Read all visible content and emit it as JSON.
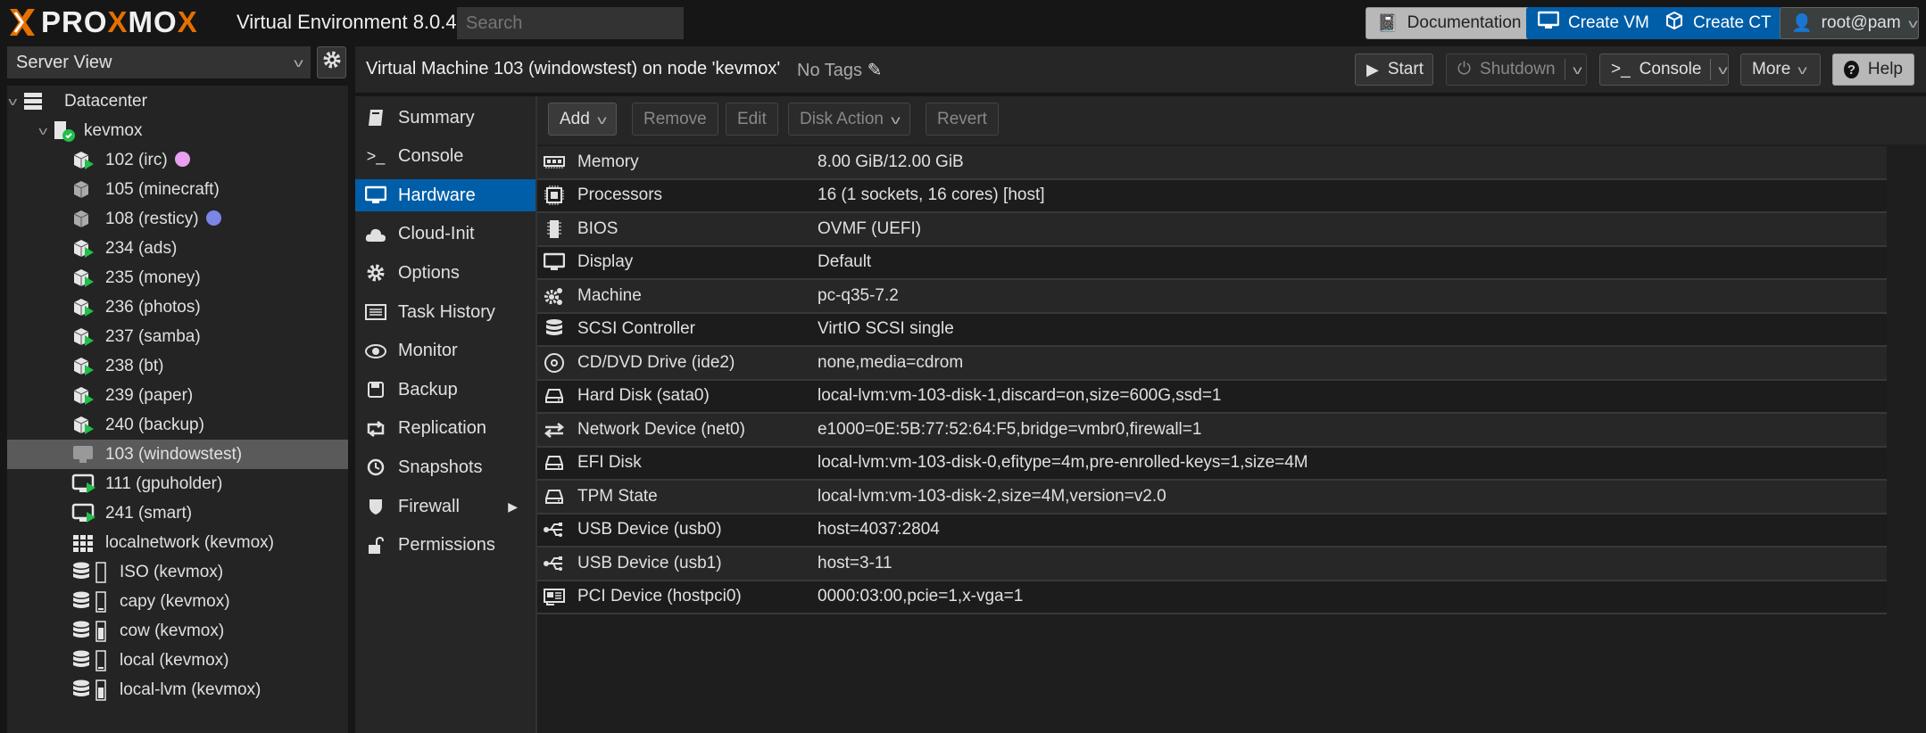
{
  "header": {
    "logo_text": "PROXMOX",
    "version": "Virtual Environment 8.0.4",
    "search_placeholder": "Search",
    "documentation": "Documentation",
    "create_vm": "Create VM",
    "create_ct": "Create CT",
    "user": "root@pam"
  },
  "sidebar": {
    "view": "Server View",
    "tree": [
      {
        "label": "Datacenter",
        "level": 0,
        "icon": "datacenter-icon",
        "expanded": true
      },
      {
        "label": "kevmox",
        "level": 1,
        "icon": "node-icon",
        "expanded": true
      },
      {
        "label": "102 (irc)",
        "level": 2,
        "icon": "container-running-icon",
        "tag_color": "#e9a0f0"
      },
      {
        "label": "105 (minecraft)",
        "level": 2,
        "icon": "container-stopped-icon"
      },
      {
        "label": "108 (resticy)",
        "level": 2,
        "icon": "container-stopped-icon",
        "tag_color": "#7b86e8"
      },
      {
        "label": "234 (ads)",
        "level": 2,
        "icon": "container-running-icon"
      },
      {
        "label": "235 (money)",
        "level": 2,
        "icon": "container-running-icon"
      },
      {
        "label": "236 (photos)",
        "level": 2,
        "icon": "container-running-icon"
      },
      {
        "label": "237 (samba)",
        "level": 2,
        "icon": "container-running-icon"
      },
      {
        "label": "238 (bt)",
        "level": 2,
        "icon": "container-running-icon"
      },
      {
        "label": "239 (paper)",
        "level": 2,
        "icon": "container-running-icon"
      },
      {
        "label": "240 (backup)",
        "level": 2,
        "icon": "container-running-icon"
      },
      {
        "label": "103 (windowstest)",
        "level": 2,
        "icon": "vm-stopped-icon",
        "selected": true
      },
      {
        "label": "111 (gpuholder)",
        "level": 2,
        "icon": "vm-running-icon"
      },
      {
        "label": "241 (smart)",
        "level": 2,
        "icon": "vm-running-icon"
      },
      {
        "label": "localnetwork (kevmox)",
        "level": 2,
        "icon": "network-grid-icon"
      },
      {
        "label": "ISO (kevmox)",
        "level": 2,
        "icon": "storage-icon",
        "usage": 0
      },
      {
        "label": "capy (kevmox)",
        "level": 2,
        "icon": "storage-icon",
        "usage": 0.1
      },
      {
        "label": "cow (kevmox)",
        "level": 2,
        "icon": "storage-icon",
        "usage": 0.65
      },
      {
        "label": "local (kevmox)",
        "level": 2,
        "icon": "storage-icon",
        "usage": 0.1
      },
      {
        "label": "local-lvm (kevmox)",
        "level": 2,
        "icon": "storage-icon",
        "usage": 0.6
      }
    ]
  },
  "main": {
    "title": "Virtual Machine 103 (windowstest) on node 'kevmox'",
    "tags": "No Tags",
    "actions": {
      "start": "Start",
      "shutdown": "Shutdown",
      "console": "Console",
      "more": "More",
      "help": "Help"
    },
    "nav": [
      {
        "label": "Summary",
        "icon": "book-icon"
      },
      {
        "label": "Console",
        "icon": "terminal-icon"
      },
      {
        "label": "Hardware",
        "icon": "monitor-icon",
        "active": true
      },
      {
        "label": "Cloud-Init",
        "icon": "cloud-icon"
      },
      {
        "label": "Options",
        "icon": "gear-icon"
      },
      {
        "label": "Task History",
        "icon": "list-icon"
      },
      {
        "label": "Monitor",
        "icon": "eye-icon"
      },
      {
        "label": "Backup",
        "icon": "floppy-icon"
      },
      {
        "label": "Replication",
        "icon": "retweet-icon"
      },
      {
        "label": "Snapshots",
        "icon": "history-icon"
      },
      {
        "label": "Firewall",
        "icon": "shield-icon",
        "submenu": true
      },
      {
        "label": "Permissions",
        "icon": "unlock-icon"
      }
    ],
    "toolbar": {
      "add": "Add",
      "remove": "Remove",
      "edit": "Edit",
      "disk_action": "Disk Action",
      "revert": "Revert"
    },
    "hardware": [
      {
        "label": "Memory",
        "value": "8.00 GiB/12.00 GiB",
        "icon": "memory-icon"
      },
      {
        "label": "Processors",
        "value": "16 (1 sockets, 16 cores) [host]",
        "icon": "cpu-icon"
      },
      {
        "label": "BIOS",
        "value": "OVMF (UEFI)",
        "icon": "bios-chip-icon"
      },
      {
        "label": "Display",
        "value": "Default",
        "icon": "monitor-icon"
      },
      {
        "label": "Machine",
        "value": "pc-q35-7.2",
        "icon": "cogs-icon"
      },
      {
        "label": "SCSI Controller",
        "value": "VirtIO SCSI single",
        "icon": "database-icon"
      },
      {
        "label": "CD/DVD Drive (ide2)",
        "value": "none,media=cdrom",
        "icon": "cdrom-icon"
      },
      {
        "label": "Hard Disk (sata0)",
        "value": "local-lvm:vm-103-disk-1,discard=on,size=600G,ssd=1",
        "icon": "hdd-icon"
      },
      {
        "label": "Network Device (net0)",
        "value": "e1000=0E:5B:77:52:64:F5,bridge=vmbr0,firewall=1",
        "icon": "exchange-icon"
      },
      {
        "label": "EFI Disk",
        "value": "local-lvm:vm-103-disk-0,efitype=4m,pre-enrolled-keys=1,size=4M",
        "icon": "hdd-icon"
      },
      {
        "label": "TPM State",
        "value": "local-lvm:vm-103-disk-2,size=4M,version=v2.0",
        "icon": "hdd-icon"
      },
      {
        "label": "USB Device (usb0)",
        "value": "host=4037:2804",
        "icon": "usb-icon"
      },
      {
        "label": "USB Device (usb1)",
        "value": "host=3-11",
        "icon": "usb-icon"
      },
      {
        "label": "PCI Device (hostpci0)",
        "value": "0000:03:00,pcie=1,x-vga=1",
        "icon": "pci-card-icon"
      }
    ]
  },
  "colors": {
    "accent": "#005ea8",
    "running": "#21bf4b",
    "orange": "#e57000"
  }
}
